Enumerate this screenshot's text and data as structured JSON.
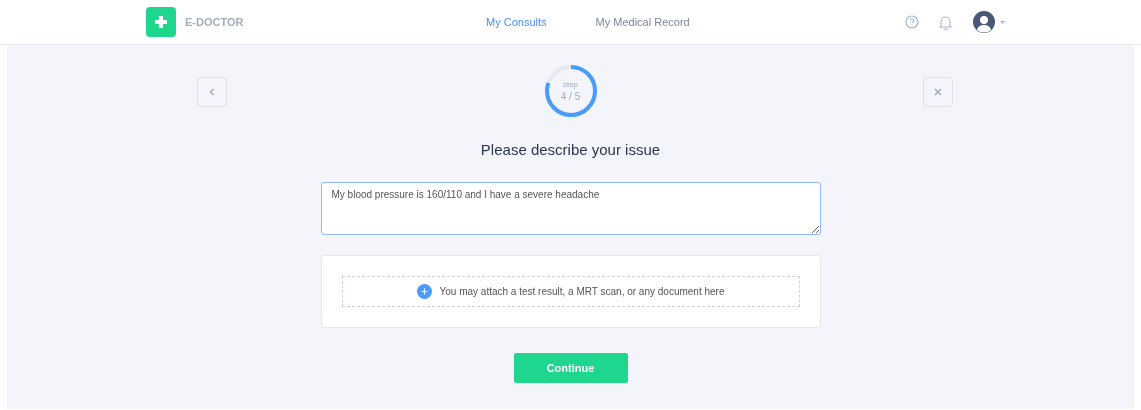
{
  "header": {
    "brand": "E-DOCTOR",
    "nav": [
      {
        "label": "My Consults",
        "selected": true
      },
      {
        "label": "My Medical Record",
        "selected": false
      }
    ]
  },
  "progress": {
    "caption": "step",
    "reading": "4 / 5"
  },
  "title": "Please describe your issue",
  "issue_field": {
    "value": "My blood pressure is 160/110 and I have a severe headache"
  },
  "attachment": {
    "hint": "You may attach a test result, a MRT scan, or any document here"
  },
  "continue_button": "Continue"
}
